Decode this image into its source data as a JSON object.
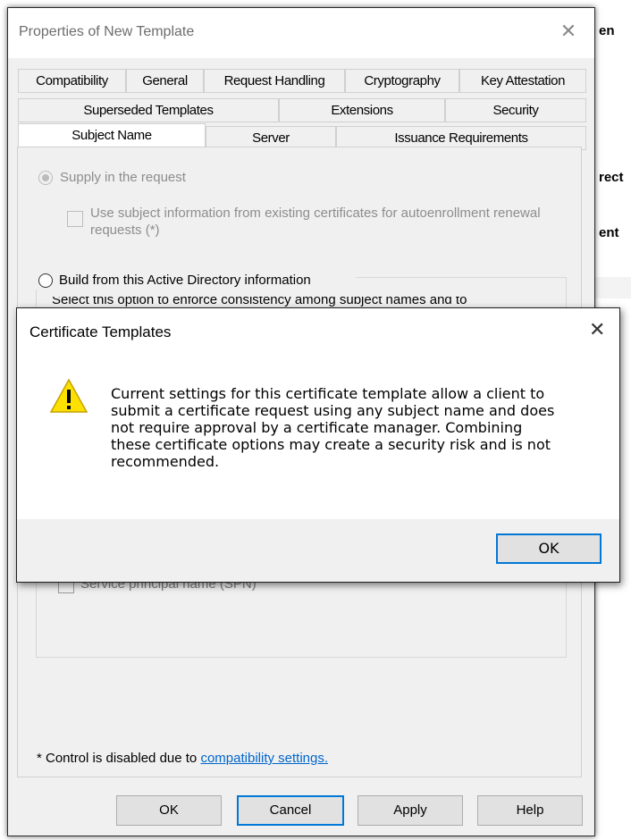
{
  "background_window": {
    "edge_fragments": [
      "en",
      "rect",
      "ent"
    ]
  },
  "properties": {
    "title": "Properties of New Template",
    "tabs_row1": [
      "Compatibility",
      "General",
      "Request Handling",
      "Cryptography",
      "Key Attestation"
    ],
    "tabs_row2": [
      "Superseded Templates",
      "Extensions",
      "Security"
    ],
    "tabs_row3": [
      "Subject Name",
      "Server",
      "Issuance Requirements"
    ],
    "active_tab": "Subject Name",
    "supply_in_request": "Supply in the request",
    "use_subject_info": "Use subject information from existing certificates for autoenrollment renewal requests (*)",
    "build_from_ad": "Build from this Active Directory information",
    "select_option_partial": "Select this option to enforce consistency among subject names and to",
    "spn_label": "Service principal name (SPN)",
    "footnote_prefix": "* Control is disabled due to ",
    "footnote_link": "compatibility settings.",
    "buttons": {
      "ok": "OK",
      "cancel": "Cancel",
      "apply": "Apply",
      "help": "Help"
    }
  },
  "modal": {
    "title": "Certificate Templates",
    "message": "Current settings for this certificate template allow a client to\nsubmit a certificate request using any subject name and does\nnot require approval by a certificate manager. Combining\nthese certificate options may create a security risk and is not\nrecommended.",
    "ok": "OK",
    "icon": "warning-icon"
  },
  "colors": {
    "accent": "#0078d7",
    "link": "#0066cc",
    "warning": "#fce100"
  }
}
